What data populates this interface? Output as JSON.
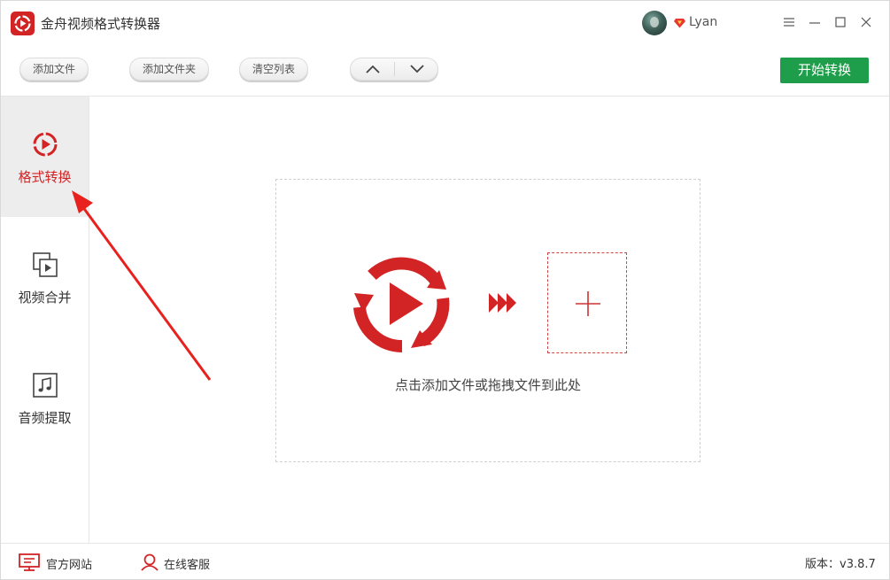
{
  "window": {
    "title": "金舟视频格式转换器",
    "user_name": "Lyan",
    "controls": {
      "menu": "menu-icon",
      "minimize": "minimize-icon",
      "maximize": "maximize-icon",
      "close": "close-icon"
    }
  },
  "toolbar": {
    "add_file": "添加文件",
    "add_folder": "添加文件夹",
    "clear_list": "清空列表",
    "move_up": "chevron-up-icon",
    "move_down": "chevron-down-icon",
    "start": "开始转换"
  },
  "sidebar": {
    "items": [
      {
        "label": "格式转换",
        "icon": "format-convert-icon",
        "active": true
      },
      {
        "label": "视频合并",
        "icon": "video-merge-icon",
        "active": false
      },
      {
        "label": "音频提取",
        "icon": "audio-extract-icon",
        "active": false
      }
    ]
  },
  "main": {
    "drop_hint": "点击添加文件或拖拽文件到此处"
  },
  "status": {
    "website": "官方网站",
    "support": "在线客服",
    "version": "版本：v3.8.7"
  },
  "colors": {
    "brand_red": "#d32425",
    "start_green": "#1e9e4a",
    "active_bg": "#ededed"
  }
}
